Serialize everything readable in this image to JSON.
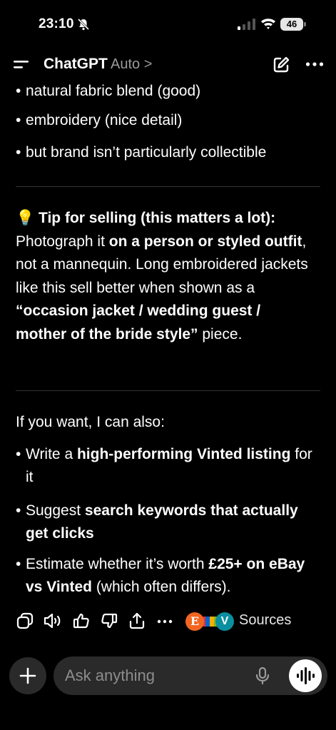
{
  "status_bar": {
    "time": "23:10",
    "battery": "46"
  },
  "header": {
    "title": "ChatGPT",
    "model": "Auto >"
  },
  "message": {
    "top_bullets": [
      "natural fabric blend (good)",
      "embroidery (nice detail)",
      "but brand isn’t particularly collectible"
    ],
    "tip": {
      "emoji": "💡",
      "heading": "Tip for selling (this matters a lot):",
      "t1": "Photograph it ",
      "b1": "on a person or styled outfit",
      "t2": ", not a mannequin. Long embroidered jackets like this sell better when shown as a ",
      "b2": "“occasion jacket / wedding guest / mother of the bride style”",
      "t3": " piece."
    },
    "intro": "If you want, I can also:",
    "offer_bullets": [
      {
        "t1": "Write a ",
        "b1": "high-performing Vinted listing",
        "t2": " for it"
      },
      {
        "t1": "Suggest ",
        "b1": "search keywords that actually get clicks",
        "t2": ""
      },
      {
        "t1": "Estimate whether it’s worth ",
        "b1": "£25+ on eBay vs Vinted",
        "t2": " (which often differs)."
      }
    ]
  },
  "actions": {
    "sources_label": "Sources",
    "source_e": "E",
    "source_v": "V"
  },
  "composer": {
    "placeholder": "Ask anything"
  },
  "colors": {
    "background": "#000000",
    "surface": "#2a2a2a",
    "divider": "#333333",
    "etsy": "#f16521",
    "vinted": "#0a8fa0"
  }
}
